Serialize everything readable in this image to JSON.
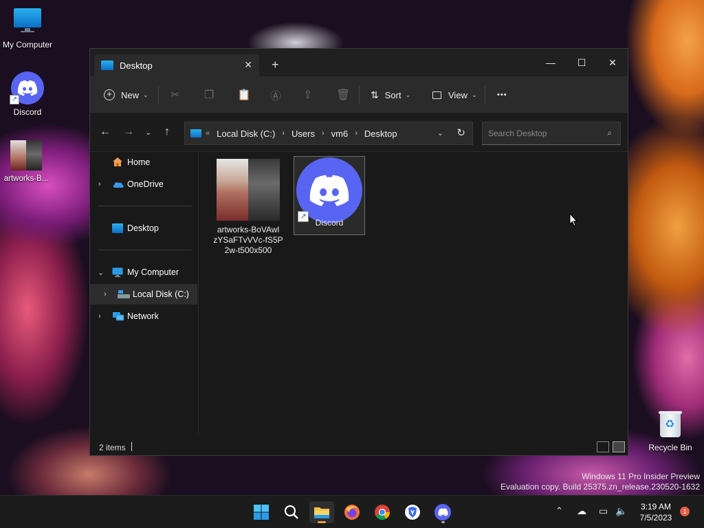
{
  "desktop": {
    "icons": [
      {
        "label": "My Computer",
        "icon": "monitor-icon"
      },
      {
        "label": "Discord",
        "icon": "discord-icon"
      },
      {
        "label": "artworks-B...",
        "icon": "image-thumbnail"
      },
      {
        "label": "Recycle Bin",
        "icon": "recycle-bin-icon"
      }
    ],
    "watermark": {
      "line1": "Windows 11 Pro Insider Preview",
      "line2": "Evaluation copy. Build 25375.zn_release.230520-1632"
    }
  },
  "window": {
    "tab_title": "Desktop",
    "tab_close": "✕",
    "new_tab": "+",
    "controls": {
      "minimize": "—",
      "maximize": "☐",
      "close": "✕"
    }
  },
  "toolbar": {
    "new_label": "New",
    "sort_label": "Sort",
    "view_label": "View",
    "more_label": "•••"
  },
  "address": {
    "overflow": "«",
    "crumbs": [
      "Local Disk (C:)",
      "Users",
      "vm6",
      "Desktop"
    ],
    "search_placeholder": "Search Desktop"
  },
  "nav_pane": {
    "items": [
      {
        "label": "Home",
        "icon": "home-icon",
        "expandable": false
      },
      {
        "label": "OneDrive",
        "icon": "cloud-icon",
        "expandable": true
      },
      {
        "label": "Desktop",
        "icon": "desktop-folder-icon",
        "expandable": false
      },
      {
        "label": "My Computer",
        "icon": "monitor-icon",
        "expanded": true
      },
      {
        "label": "Local Disk (C:)",
        "icon": "drive-icon",
        "expandable": true,
        "selected": true
      },
      {
        "label": "Network",
        "icon": "network-icon",
        "expandable": true
      }
    ]
  },
  "files": [
    {
      "name": "artworks-BoVAwlzYSaFTvVVc-fS5P2w-t500x500",
      "line1": "artworks-BoVAwl",
      "line2": "zYSaFTvVVc-fS5P",
      "line3": "2w-t500x500",
      "type": "image"
    },
    {
      "name": "Discord",
      "type": "shortcut",
      "selected": true
    }
  ],
  "status": {
    "count": "2 items"
  },
  "taskbar": {
    "apps": [
      "start-icon",
      "search-icon",
      "file-explorer-icon",
      "firefox-icon",
      "chrome-icon",
      "brave-icon",
      "discord-icon"
    ],
    "time": "3:19 AM",
    "date": "7/5/2023",
    "notifications": "1"
  },
  "colors": {
    "accent": "#5865f2",
    "folder": "#f2c14e",
    "window_bg": "#191919"
  }
}
